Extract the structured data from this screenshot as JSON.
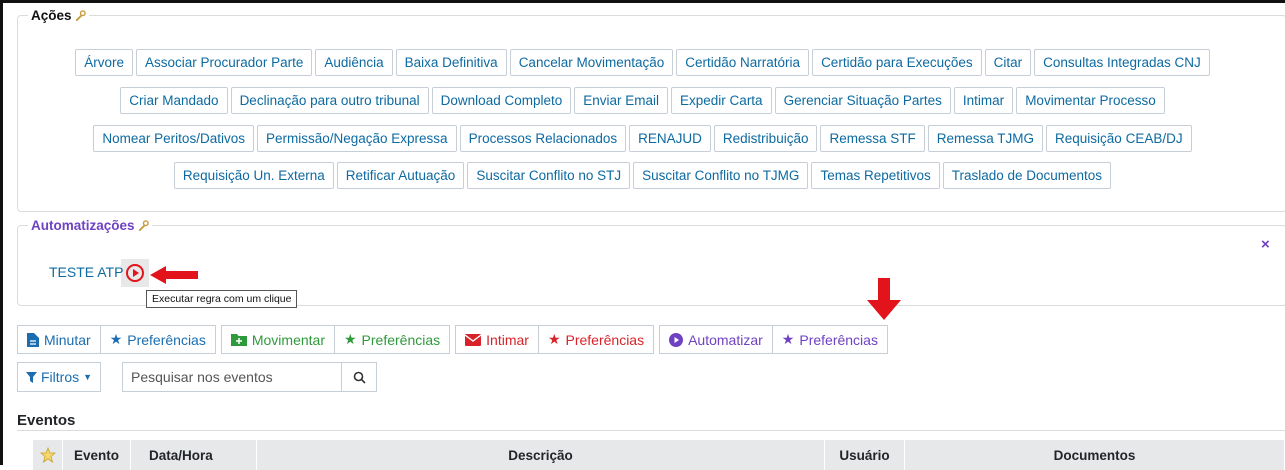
{
  "acoes": {
    "title": "Ações",
    "rows": [
      [
        "Árvore",
        "Associar Procurador Parte",
        "Audiência",
        "Baixa Definitiva",
        "Cancelar Movimentação",
        "Certidão Narratória",
        "Certidão para Execuções",
        "Citar",
        "Consultas Integradas CNJ"
      ],
      [
        "Criar Mandado",
        "Declinação para outro tribunal",
        "Download Completo",
        "Enviar Email",
        "Expedir Carta",
        "Gerenciar Situação Partes",
        "Intimar",
        "Movimentar Processo"
      ],
      [
        "Nomear Peritos/Dativos",
        "Permissão/Negação Expressa",
        "Processos Relacionados",
        "RENAJUD",
        "Redistribuição",
        "Remessa STF",
        "Remessa TJMG",
        "Requisição CEAB/DJ"
      ],
      [
        "Requisição Un. Externa",
        "Retificar Autuação",
        "Suscitar Conflito no STJ",
        "Suscitar Conflito no TJMG",
        "Temas Repetitivos",
        "Traslado de Documentos"
      ]
    ]
  },
  "automatizacoes": {
    "title": "Automatizações",
    "item_label": "TESTE ATP",
    "tooltip": "Executar regra com um clique",
    "close_label": "×"
  },
  "toolbar": {
    "minutar": "Minutar",
    "minutar_pref": "Preferências",
    "movimentar": "Movimentar",
    "movimentar_pref": "Preferências",
    "intimar": "Intimar",
    "intimar_pref": "Preferências",
    "automatizar": "Automatizar",
    "automatizar_pref": "Preferências"
  },
  "filter": {
    "filtros_label": "Filtros",
    "search_placeholder": "Pesquisar nos eventos"
  },
  "eventos": {
    "title": "Eventos",
    "columns": [
      "Evento",
      "Data/Hora",
      "Descrição",
      "Usuário",
      "Documentos"
    ]
  },
  "colors": {
    "link": "#0d6aa1",
    "green": "#2f9a3b",
    "red": "#d8232a",
    "purple": "#6f42c1",
    "annotation_arrow": "#e3131b"
  }
}
